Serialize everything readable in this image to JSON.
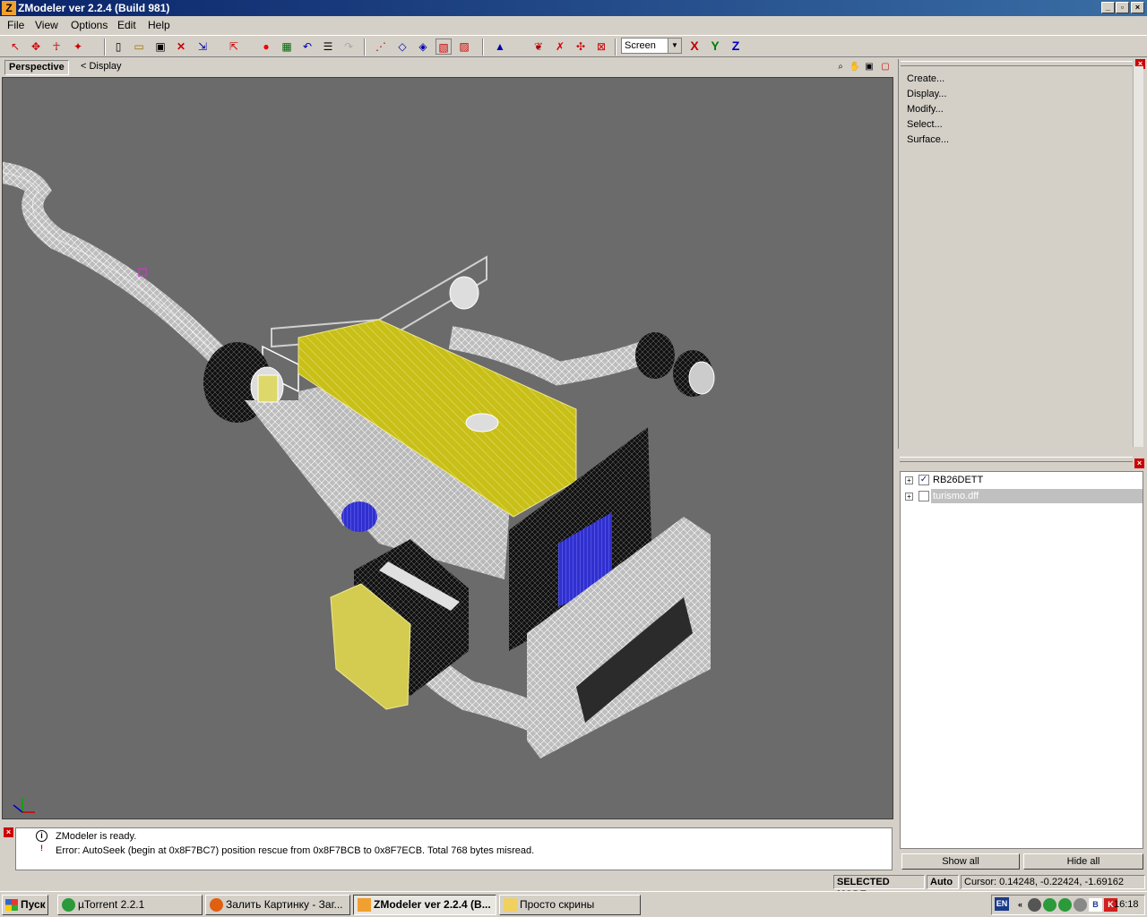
{
  "window": {
    "title": "ZModeler ver 2.2.4 (Build 981)",
    "icon_letter": "Z"
  },
  "menu": [
    {
      "label": "File"
    },
    {
      "label": "View"
    },
    {
      "label": "Options"
    },
    {
      "label": "Edit"
    },
    {
      "label": "Help"
    }
  ],
  "toolbar": {
    "snap_mode": "Screen",
    "axes": [
      "X",
      "Y",
      "Z"
    ],
    "axis_colors": [
      "#c00000",
      "#008000",
      "#0000c0"
    ]
  },
  "viewport": {
    "tab": "Perspective",
    "display_label": "<  Display",
    "background": "#6b6b6b"
  },
  "commands": [
    "Create...",
    "Display...",
    "Modify...",
    "Select...",
    "Surface..."
  ],
  "tree": [
    {
      "label": "RB26DETT",
      "checked": true
    },
    {
      "label": "turismo.dff",
      "checked": false
    }
  ],
  "buttons": {
    "show_all": "Show all",
    "hide_all": "Hide all"
  },
  "log": [
    {
      "type": "info",
      "text": "ZModeler is ready."
    },
    {
      "type": "error",
      "text": "Error: AutoSeek (begin at 0x8F7BC7) position rescue  from 0x8F7BCB to 0x8F7ECB. Total 768 bytes misread."
    }
  ],
  "status": {
    "mode": "SELECTED MODE",
    "auto": "Auto",
    "cursor": "Cursor: 0.14248, -0.22424, -1.69162"
  },
  "taskbar": {
    "start": "Пуск",
    "tasks": [
      {
        "label": "µTorrent 2.2.1",
        "active": false
      },
      {
        "label": "Залить Картинку - Заг...",
        "active": false
      },
      {
        "label": "ZModeler ver 2.2.4 (B...",
        "active": true
      },
      {
        "label": "Просто скрины",
        "active": false
      }
    ],
    "lang": "EN",
    "clock": "16:18"
  }
}
